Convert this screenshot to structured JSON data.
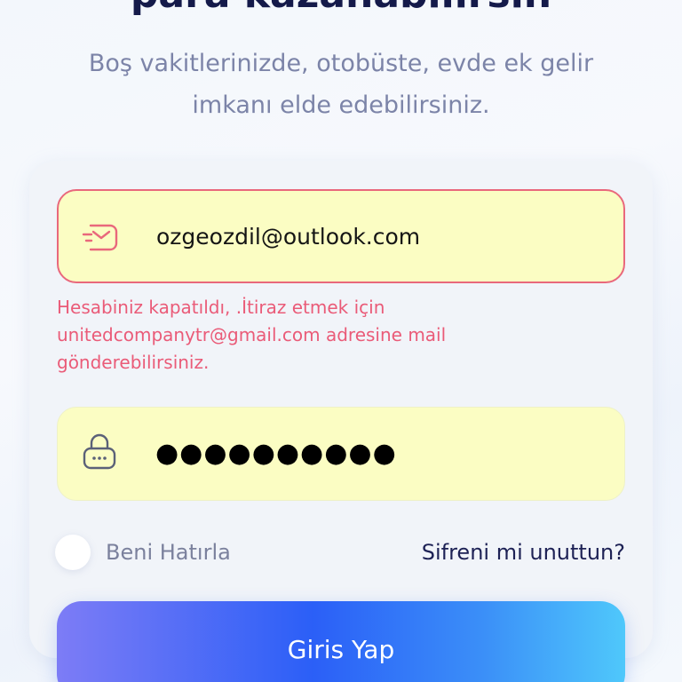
{
  "header": {
    "headline": "para kazanabilirsin",
    "subtitle_line1": "Boş vakitlerinizde, otobüste, evde ek gelir",
    "subtitle_line2": "imkanı elde edebilirsiniz."
  },
  "form": {
    "email": {
      "value": "ozgeozdil@outlook.com",
      "icon": "mail-icon"
    },
    "error": {
      "line1": "Hesabiniz kapatıldı, .İtiraz etmek için",
      "line2": "unitedcompanytr@gmail.com adresine mail",
      "line3": "gönderebilirsiniz."
    },
    "password": {
      "value": "●●●●●●●●●●",
      "icon": "lock-icon"
    },
    "remember_label": "Beni Hatırla",
    "forgot_label": "Sifreni mi unuttun?",
    "submit_label": "Giris Yap"
  },
  "colors": {
    "field_background": "#fbfdc3",
    "error": "#ea5b78",
    "title": "#141a4a",
    "accent_start": "#7d7cf6",
    "accent_mid": "#2b5ff7",
    "accent_end": "#4fc8fb"
  }
}
